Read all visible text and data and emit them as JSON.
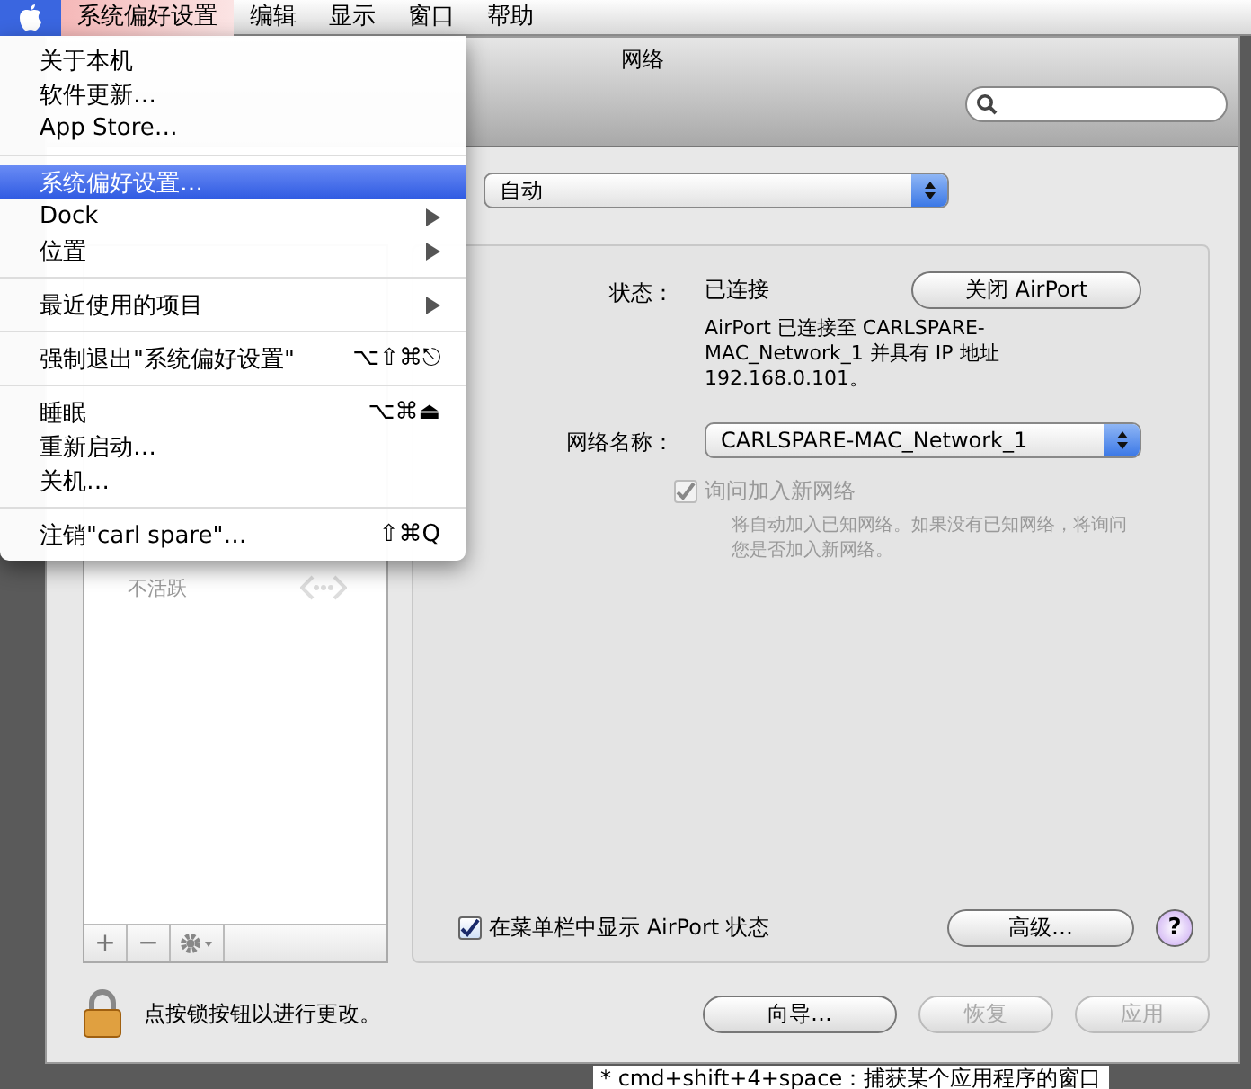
{
  "menubar": {
    "items": [
      {
        "label": "系统偏好设置",
        "selected": true
      },
      {
        "label": "编辑",
        "selected": false
      },
      {
        "label": "显示",
        "selected": false
      },
      {
        "label": "窗口",
        "selected": false
      },
      {
        "label": "帮助",
        "selected": false
      }
    ]
  },
  "apple_menu": {
    "items": [
      {
        "kind": "item",
        "label": "关于本机",
        "selected": false
      },
      {
        "kind": "item",
        "label": "软件更新…",
        "selected": false
      },
      {
        "kind": "item",
        "label": "App Store…",
        "selected": false
      },
      {
        "kind": "separator"
      },
      {
        "kind": "item",
        "label": "系统偏好设置…",
        "selected": true
      },
      {
        "kind": "submenu",
        "label": "Dock",
        "selected": false
      },
      {
        "kind": "submenu",
        "label": "位置",
        "selected": false
      },
      {
        "kind": "separator"
      },
      {
        "kind": "submenu",
        "label": "最近使用的项目",
        "selected": false
      },
      {
        "kind": "separator"
      },
      {
        "kind": "item",
        "label": "强制退出\"系统偏好设置\"",
        "shortcut": "⌥⇧⌘⎋",
        "selected": false
      },
      {
        "kind": "separator"
      },
      {
        "kind": "item",
        "label": "睡眠",
        "shortcut": "⌥⌘⏏",
        "selected": false
      },
      {
        "kind": "item",
        "label": "重新启动…",
        "selected": false
      },
      {
        "kind": "item",
        "label": "关机…",
        "selected": false
      },
      {
        "kind": "separator"
      },
      {
        "kind": "item",
        "label": "注销\"carl spare\"…",
        "shortcut": "⇧⌘Q",
        "selected": false
      }
    ]
  },
  "window": {
    "title": "网络"
  },
  "location": {
    "value": "自动"
  },
  "sidebar": {
    "items": [
      {
        "status": "不活跃"
      }
    ],
    "add": "+",
    "remove": "−"
  },
  "detail": {
    "status_label": "状态：",
    "status_value": "已连接",
    "toggle_button": "关闭 AirPort",
    "description": "AirPort 已连接至 CARLSPARE-MAC_Network_1 并具有 IP 地址 192.168.0.101。",
    "network_label": "网络名称：",
    "network_value": "CARLSPARE-MAC_Network_1",
    "ask_checkbox": {
      "label": "询问加入新网络",
      "checked": true,
      "disabled": true
    },
    "ask_hint": "将自动加入已知网络。如果没有已知网络，将询问您是否加入新网络。",
    "show_checkbox": {
      "label": "在菜单栏中显示 AirPort 状态",
      "checked": true,
      "disabled": false
    },
    "advanced_button": "高级…",
    "help": "?"
  },
  "lock_text": "点按锁按钮以进行更改。",
  "buttons": [
    {
      "label": "向导…",
      "disabled": false
    },
    {
      "label": "恢复",
      "disabled": true
    },
    {
      "label": "应用",
      "disabled": true
    }
  ],
  "background_note": "* cmd+shift+4+space：捕获某个应用程序的窗口"
}
